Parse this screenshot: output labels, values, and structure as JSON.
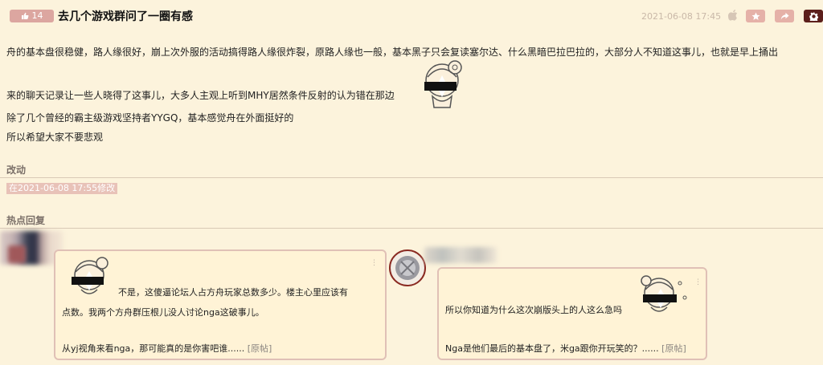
{
  "header": {
    "like_count": "14",
    "title": "去几个游戏群问了一圈有感",
    "datetime": "2021-06-08 17:45"
  },
  "post": {
    "lines": [
      "舟的基本盘很稳健，路人缘很好，崩上次外服的活动搞得路人缘很炸裂，原路人缘也一般，基本黑子只会复读塞尔达、什么黑暗巴拉巴拉的，大部分人不知道这事儿，也就是早上捅出",
      "来的聊天记录让一些人晓得了这事儿，大多人主观上听到MHY居然条件反射的认为错在那边",
      "除了几个曾经的霸主级游戏坚持者YYGQ，基本感觉舟在外面挺好的",
      "所以希望大家不要悲观"
    ]
  },
  "edit_section": {
    "heading": "改动",
    "note": "在2021-06-08 17:55修改"
  },
  "hot_replies": {
    "heading": "热点回复",
    "replies": [
      {
        "line1": "不是，这傻逼论坛人占方舟玩家总数多少。楼主心里应该有",
        "line2": "点数。我两个方舟群压根儿没人讨论nga这破事儿。",
        "line3": "从yj视角来看nga，那可能真的是你害吧谁......",
        "source": "[原帖]",
        "menu": "⋮"
      },
      {
        "line1": "所以你知道为什么这次崩版头上的人这么急吗",
        "line2": "Nga是他们最后的基本盘了，米ga跟你开玩笑的？......",
        "source": "[原帖]",
        "menu": "⋮"
      }
    ]
  },
  "icons": {
    "like": "thumbs-up-icon",
    "apple": "apple-icon",
    "star": "star-icon",
    "share": "share-icon",
    "settings": "gear-icon",
    "sticker": "chibi-girl-sticker"
  },
  "colors": {
    "background": "#fcf3dc",
    "accent": "#e5b1a8",
    "dark_accent": "#5c1f1b",
    "card_border": "#e0c0b6"
  }
}
